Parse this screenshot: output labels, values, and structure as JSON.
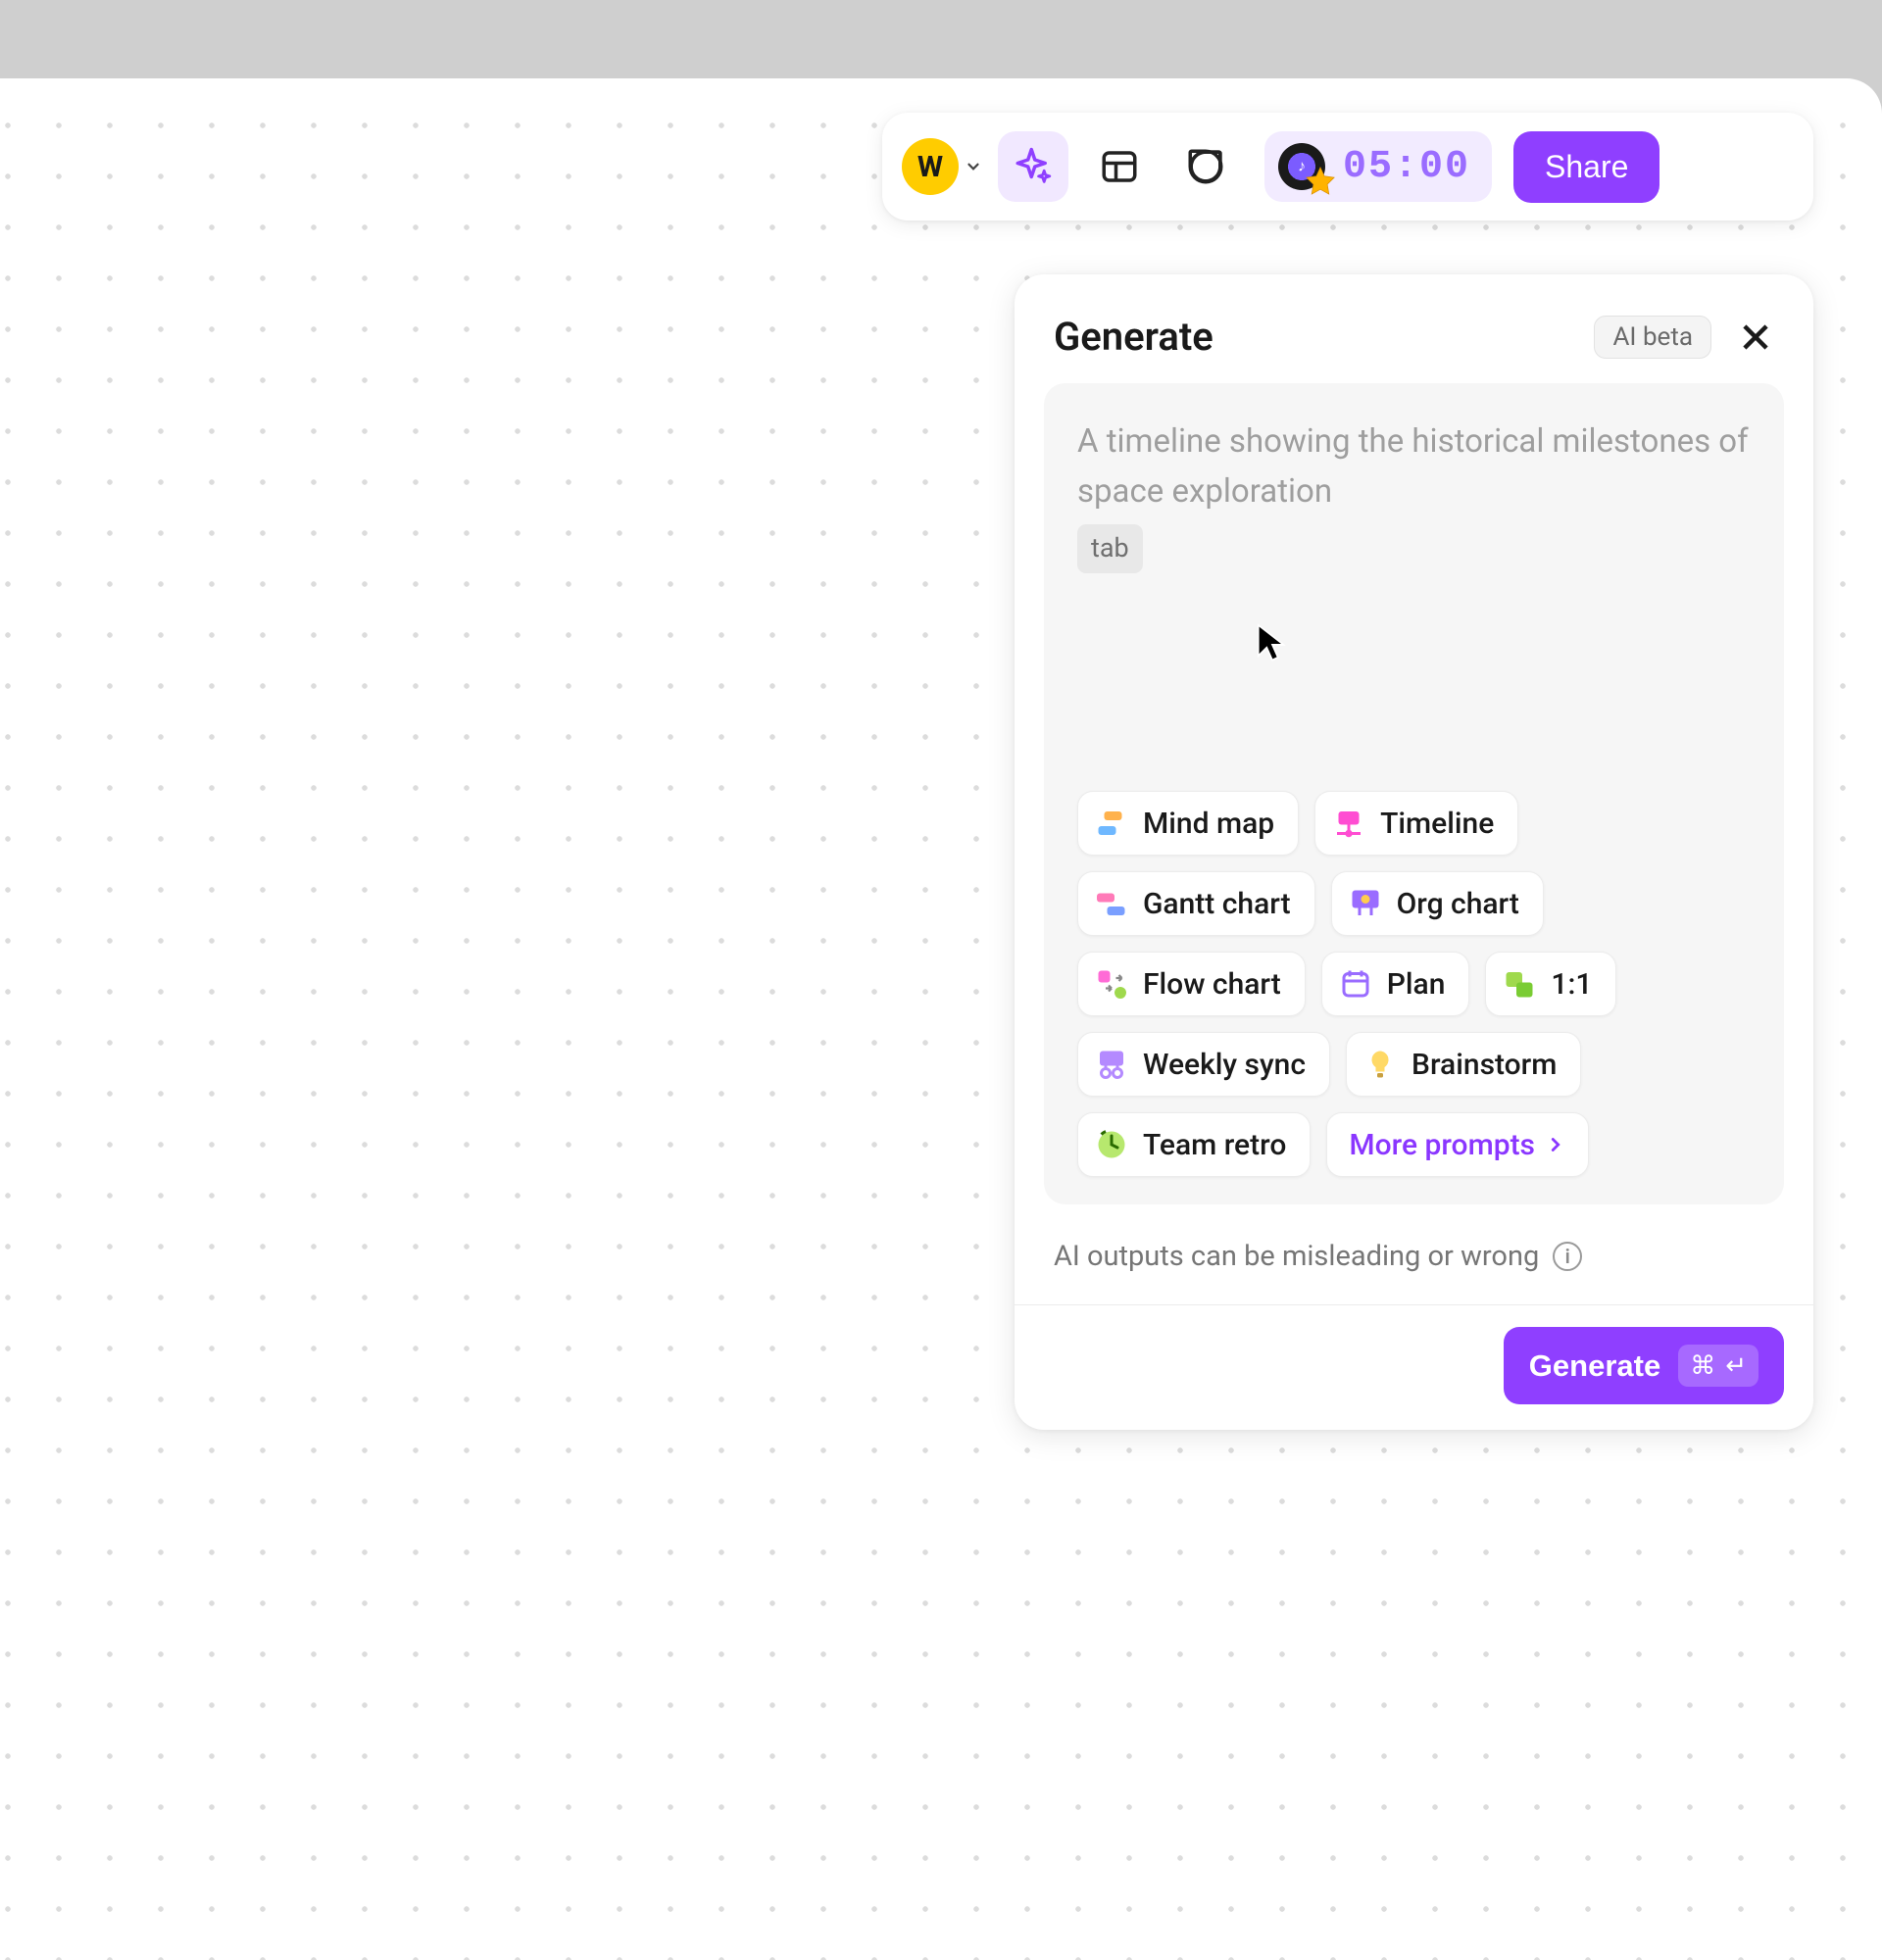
{
  "toolbar": {
    "avatar_initial": "W",
    "timer_value": "05:00",
    "share_label": "Share"
  },
  "panel": {
    "title": "Generate",
    "badge": "AI beta",
    "prompt_placeholder": "A timeline showing the historical milestones of space exploration",
    "tab_hint": "tab",
    "templates": [
      {
        "label": "Mind map",
        "icon": "mindmap"
      },
      {
        "label": "Timeline",
        "icon": "timeline"
      },
      {
        "label": "Gantt chart",
        "icon": "gantt"
      },
      {
        "label": "Org chart",
        "icon": "orgchart"
      },
      {
        "label": "Flow chart",
        "icon": "flowchart"
      },
      {
        "label": "Plan",
        "icon": "plan"
      },
      {
        "label": "1:1",
        "icon": "oneonone"
      },
      {
        "label": "Weekly sync",
        "icon": "weeklysync"
      },
      {
        "label": "Brainstorm",
        "icon": "brainstorm"
      },
      {
        "label": "Team retro",
        "icon": "teamretro"
      }
    ],
    "more_prompts_label": "More prompts",
    "disclaimer": "AI outputs can be misleading or wrong",
    "generate_button_label": "Generate",
    "shortcut_keys": [
      "⌘",
      "↵"
    ]
  }
}
